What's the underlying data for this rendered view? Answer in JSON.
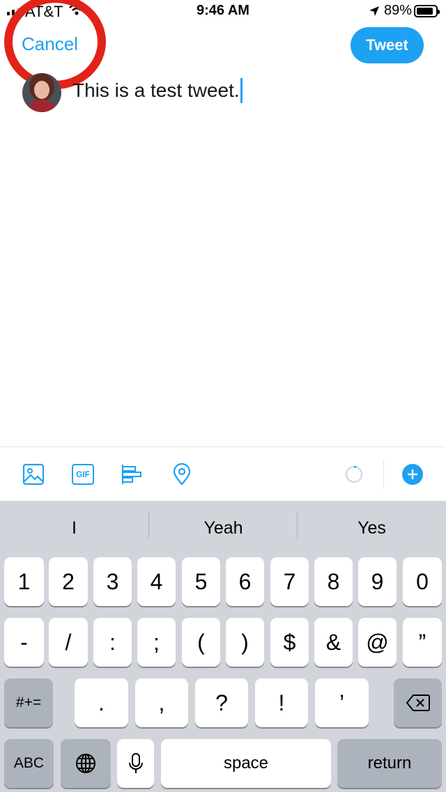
{
  "status_bar": {
    "carrier": "AT&T",
    "time": "9:46 AM",
    "battery_percent": "89%",
    "battery_level": 0.89,
    "signal_bars_filled": 2,
    "icons": [
      "signal-icon",
      "wifi-icon",
      "location-arrow-icon",
      "battery-icon"
    ]
  },
  "nav": {
    "cancel_label": "Cancel",
    "tweet_label": "Tweet"
  },
  "composer": {
    "text": "This is a test tweet."
  },
  "toolbar": {
    "icons": [
      "image-icon",
      "gif-icon",
      "poll-icon",
      "location-icon",
      "character-count-ring-icon",
      "add-tweet-icon"
    ],
    "gif_label": "GIF"
  },
  "keyboard": {
    "suggestions": [
      "I",
      "Yeah",
      "Yes"
    ],
    "row1": [
      "1",
      "2",
      "3",
      "4",
      "5",
      "6",
      "7",
      "8",
      "9",
      "0"
    ],
    "row2": [
      "-",
      "/",
      ":",
      ";",
      "(",
      ")",
      "$",
      "&",
      "@",
      "”"
    ],
    "row3": {
      "mode_key": "#+=",
      "keys": [
        ".",
        ",",
        "?",
        "!",
        "’"
      ],
      "delete_icon": "backspace-icon"
    },
    "row4": {
      "abc_label": "ABC",
      "globe_icon": "globe-icon",
      "mic_icon": "microphone-icon",
      "space_label": "space",
      "return_label": "return"
    }
  },
  "colors": {
    "accent": "#1da1f2",
    "annotation_circle": "#e2231a",
    "keyboard_bg": "#d1d4da",
    "key_dark": "#adb3bc"
  }
}
